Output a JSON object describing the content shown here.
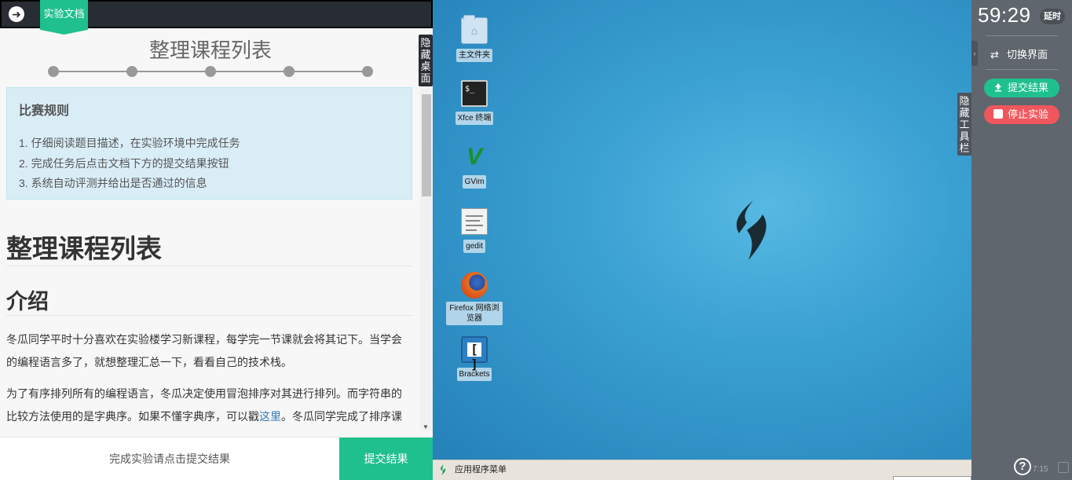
{
  "doc": {
    "tab_label": "实验文档",
    "title": "整理课程列表",
    "step_count": 5,
    "rules": {
      "heading": "比赛规则",
      "items": [
        "1. 仔细阅读题目描述，在实验环境中完成任务",
        "2. 完成任务后点击文档下方的提交结果按钮",
        "3. 系统自动评测并给出是否通过的信息"
      ]
    },
    "h1": "整理课程列表",
    "h2": "介绍",
    "para1": "冬瓜同学平时十分喜欢在实验楼学习新课程，每学完一节课就会将其记下。当学会的编程语言多了，就想整理汇总一下，看看自己的技术栈。",
    "para2_before_link": "为了有序排列所有的编程语言，冬瓜决定使用冒泡排序对其进行排列。而字符串的比较方法使用的是字典序。如果不懂字典序，可以戳",
    "para2_link": "这里",
    "para2_after_link": "。冬瓜同学完成了排序课",
    "hide_desktop_label": "隐藏桌面",
    "footer_hint": "完成实验请点击提交结果",
    "footer_submit": "提交结果"
  },
  "desktop": {
    "icons": [
      {
        "label": "主文件夹",
        "icon": "home-folder-icon"
      },
      {
        "label": "Xfce 终端",
        "icon": "terminal-icon"
      },
      {
        "label": "GVim",
        "icon": "gvim-icon"
      },
      {
        "label": "gedit",
        "icon": "gedit-icon"
      },
      {
        "label": "Firefox 网络浏览器",
        "icon": "firefox-icon"
      },
      {
        "label": "Brackets",
        "icon": "brackets-icon"
      }
    ],
    "terminal_prompt": "$_",
    "taskbar_menu_label": "应用程序菜单",
    "hide_toolbar_label": "隐藏工具栏"
  },
  "toolbar": {
    "timer": "59:29",
    "delay_label": "延时",
    "switch_label": "切换界面",
    "submit_label": "提交结果",
    "stop_label": "停止实验",
    "help_label": "?",
    "clock": "7:15"
  },
  "colors": {
    "accent_green": "#1fc08e",
    "stop_red": "#f0575d",
    "toolbar_bg": "#5f666d",
    "doc_topbar": "#282d33"
  }
}
